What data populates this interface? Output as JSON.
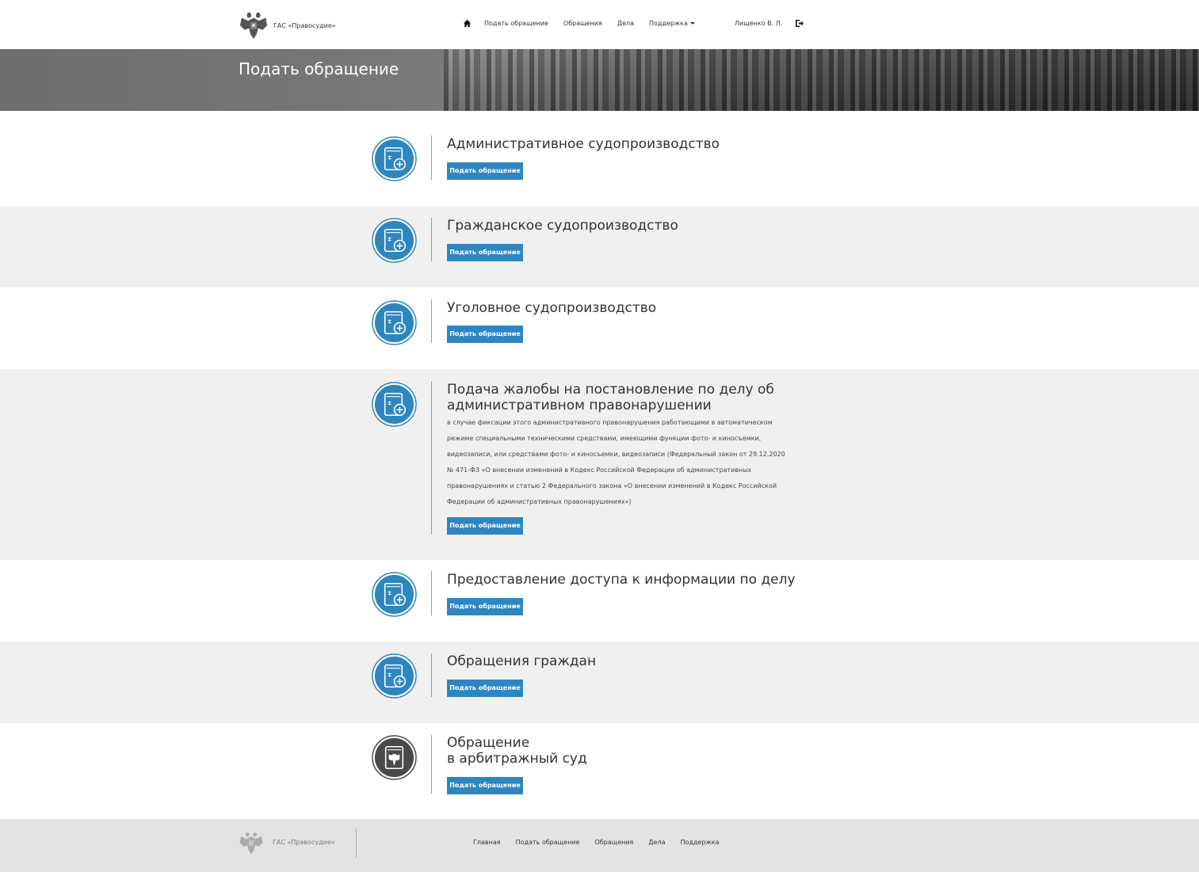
{
  "header": {
    "brand_name": "ГАС «Правосудие»",
    "nav": [
      "Подать обращение",
      "Обращения",
      "Дела",
      "Поддержка"
    ],
    "user_name": "Лищенко В. Л."
  },
  "banner": {
    "title": "Подать обращение"
  },
  "sections": [
    {
      "title": "Административное судопроизводство",
      "button": "Подать обращение",
      "icon": "book-plus-icon"
    },
    {
      "title": "Гражданское судопроизводство",
      "button": "Подать обращение",
      "icon": "book-plus-icon"
    },
    {
      "title": "Уголовное судопроизводство",
      "button": "Подать обращение",
      "icon": "book-plus-icon"
    },
    {
      "title": "Подача жалобы на постановление по делу об административном правонарушении",
      "description": "в случае фиксации этого административного правонарушения работающими в автоматическом режиме специальными техническими средствами, имеющими функции фото- и киносъемки, видеозаписи, или средствами фото- и киносъемки, видеозаписи (Федеральный закон от 29.12.2020 № 471-ФЗ «О внесении изменений в Кодекс Российской Федерации об административных правонарушениях и статью 2 Федерального закона «О внесении изменений в Кодекс Российской Федерации об административных правонарушениях»)",
      "button": "Подать обращение",
      "icon": "book-plus-icon"
    },
    {
      "title": "Предоставление доступа к информации по делу",
      "button": "Подать обращение",
      "icon": "book-plus-icon"
    },
    {
      "title": "Обращения граждан",
      "button": "Подать обращение",
      "icon": "book-plus-icon"
    },
    {
      "title": "Обращение",
      "title_line2": "в арбитражный суд",
      "button": "Подать обращение",
      "icon": "emblem-book-icon"
    }
  ],
  "footer": {
    "brand_name": "ГАС «Правосудие»",
    "nav": [
      "Главная",
      "Подать обращение",
      "Обращения",
      "Дела",
      "Поддержка"
    ]
  },
  "colors": {
    "accent": "#2e86c1",
    "gray_section": "#f0f0f0",
    "dark_icon": "#4a4a4a"
  }
}
